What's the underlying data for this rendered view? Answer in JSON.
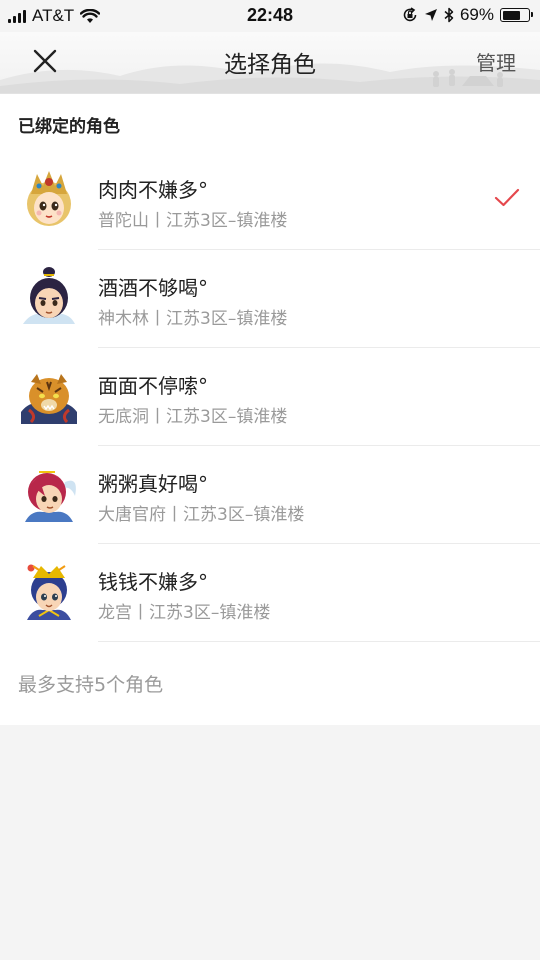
{
  "status_bar": {
    "carrier": "AT&T",
    "time": "22:48",
    "battery_text": "69%",
    "battery_level": 0.69
  },
  "nav": {
    "title": "选择角色",
    "manage_label": "管理"
  },
  "section_title": "已绑定的角色",
  "roles": [
    {
      "name": "肉肉不嫌多°",
      "detail": "普陀山丨江苏3区–镇淮楼",
      "selected": true
    },
    {
      "name": "酒酒不够喝°",
      "detail": "神木林丨江苏3区–镇淮楼",
      "selected": false
    },
    {
      "name": "面面不停嗦°",
      "detail": "无底洞丨江苏3区–镇淮楼",
      "selected": false
    },
    {
      "name": "粥粥真好喝°",
      "detail": "大唐官府丨江苏3区–镇淮楼",
      "selected": false
    },
    {
      "name": "钱钱不嫌多°",
      "detail": "龙宫丨江苏3区–镇淮楼",
      "selected": false
    }
  ],
  "limit_note": "最多支持5个角色",
  "colors": {
    "check": "#e5484d",
    "secondary_text": "#9a9a9a"
  }
}
